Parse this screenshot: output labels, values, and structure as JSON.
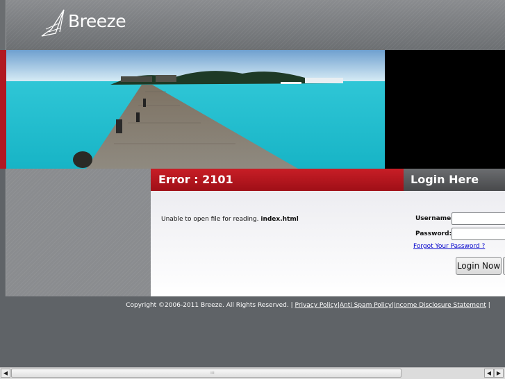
{
  "header": {
    "logo_text": "Breeze"
  },
  "error": {
    "title": "Error : 2101",
    "message_prefix": "Unable to open file for reading. ",
    "message_file": "index.html"
  },
  "login": {
    "title": "Login Here",
    "username_label": "Username:",
    "password_label": "Password:",
    "username_value": "",
    "password_value": "",
    "forgot_link": "Forgot Your Password ?",
    "submit_label": "Login Now"
  },
  "footer": {
    "copyright": "Copyright ©2006-2011 Breeze. All Rights Reserved. |",
    "links": [
      "Privacy Policy",
      "Anti Spam Policy",
      "Income Disclosure Statement"
    ],
    "separator": "|"
  },
  "colors": {
    "accent_red": "#b11822",
    "header_gray": "#7a7d80",
    "link_blue": "#0000cc"
  },
  "icons": [
    "breeze-sail-logo-icon",
    "scroll-left-arrow-icon",
    "scroll-right-arrow-icon"
  ]
}
